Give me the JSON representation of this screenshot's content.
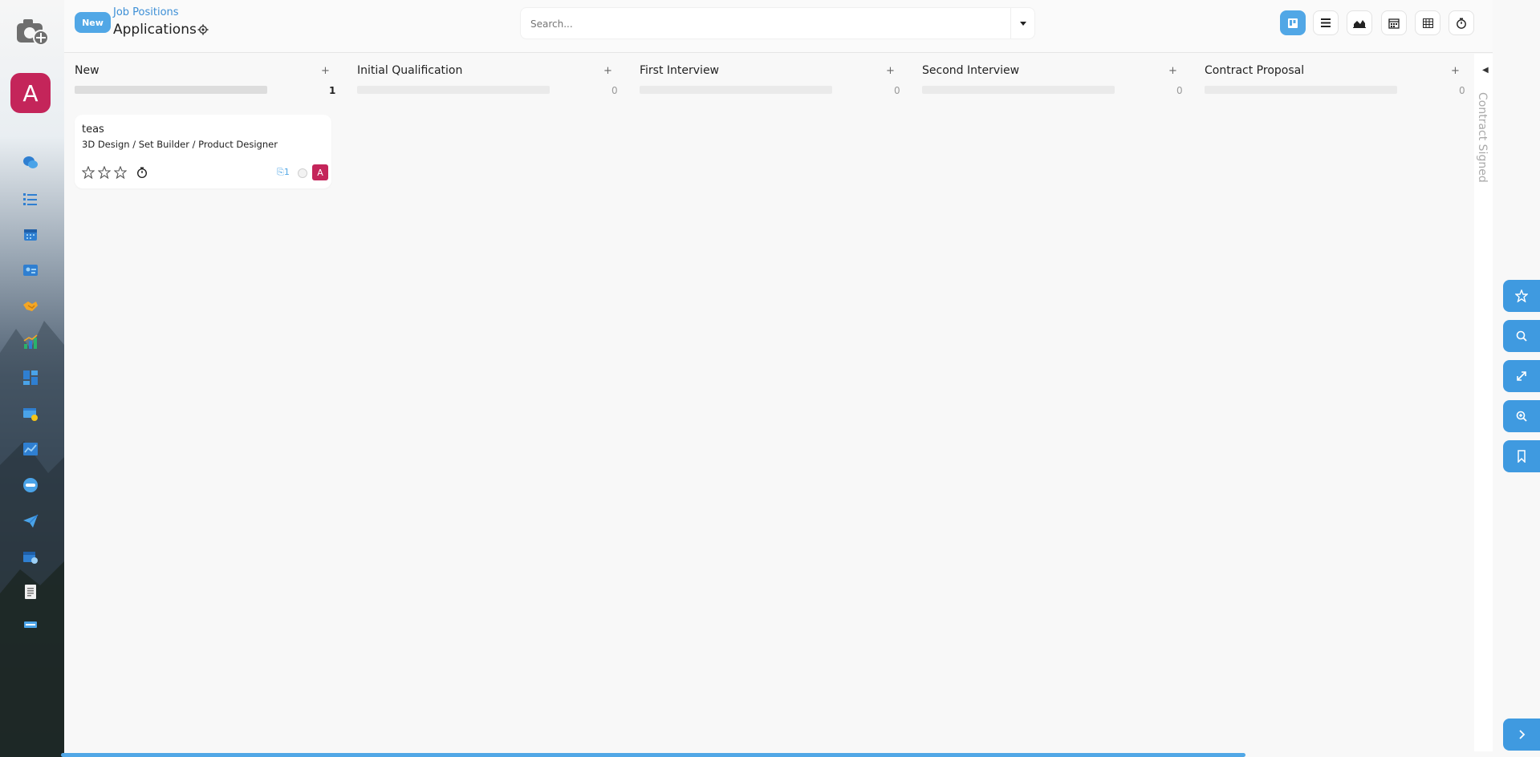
{
  "colors": {
    "accent": "#51a7e6",
    "avatar": "#c4255a",
    "float_tools": "#3f9ae0"
  },
  "sidebar": {
    "user_initial": "A",
    "apps": [
      {
        "icon": "discuss-icon"
      },
      {
        "icon": "todo-icon"
      },
      {
        "icon": "calendar-icon"
      },
      {
        "icon": "contacts-icon"
      },
      {
        "icon": "crm-icon"
      },
      {
        "icon": "sales-icon"
      },
      {
        "icon": "dashboards-icon"
      },
      {
        "icon": "website-icon"
      },
      {
        "icon": "analytics-icon"
      },
      {
        "icon": "odoo-icon"
      },
      {
        "icon": "email-marketing-icon"
      },
      {
        "icon": "events-icon"
      },
      {
        "icon": "documents-icon"
      },
      {
        "icon": "more-icon"
      }
    ]
  },
  "header": {
    "new_label": "New",
    "breadcrumb_parent": "Job Positions",
    "title": "Applications",
    "search_placeholder": "Search...",
    "views": [
      "kanban-view",
      "list-view",
      "graph-view",
      "calendar-view",
      "pivot-view",
      "activity-view"
    ],
    "active_view": "kanban-view"
  },
  "columns": [
    {
      "title": "New",
      "add": "+",
      "count": "1"
    },
    {
      "title": "Initial Qualification",
      "add": "+",
      "count": "0"
    },
    {
      "title": "First Interview",
      "add": "+",
      "count": "0"
    },
    {
      "title": "Second Interview",
      "add": "+",
      "count": "0"
    },
    {
      "title": "Contract Proposal",
      "add": "+",
      "count": "0"
    }
  ],
  "folded_column": {
    "title": "Contract Signed"
  },
  "card": {
    "name": "teas",
    "job": "3D Design / Set Builder / Product Designer",
    "attachments": "1",
    "stars_filled": 0,
    "stars_total": 3,
    "assignee_initial": "A"
  },
  "float_tools": [
    "star-icon",
    "search-icon",
    "expand-icon",
    "zoom-icon",
    "bookmark-icon",
    "chevron-right-icon"
  ]
}
